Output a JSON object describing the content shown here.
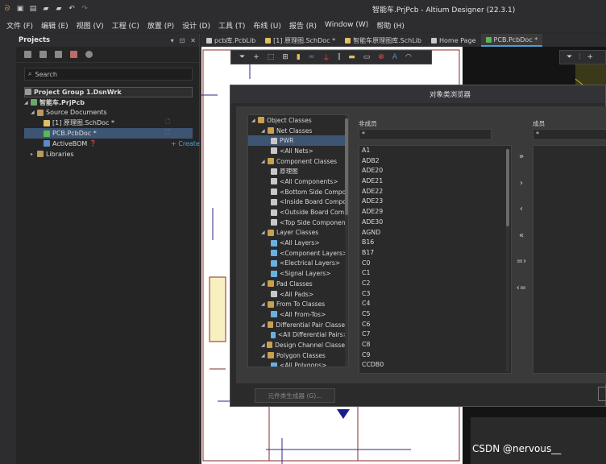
{
  "window": {
    "title": "智能车.PrjPcb - Altium Designer (22.3.1)"
  },
  "menu": [
    "文件 (F)",
    "编辑 (E)",
    "视图 (V)",
    "工程 (C)",
    "放置 (P)",
    "设计 (D)",
    "工具 (T)",
    "布线 (U)",
    "报告 (R)",
    "Window (W)",
    "帮助 (H)"
  ],
  "projects_panel": {
    "title": "Projects",
    "header_controls": [
      "▾",
      "⊡",
      "✕"
    ],
    "search_placeholder": "Search",
    "tree": {
      "group": "Project Group 1.DsnWrk",
      "project": "智能车.PrjPcb",
      "source_documents": "Source Documents",
      "sch_doc": "[1] 原理图.SchDoc *",
      "pcb_doc": "PCB.PcbDoc *",
      "active_bom": "ActiveBOM",
      "create": "+ Create",
      "libraries": "Libraries"
    }
  },
  "tabs": [
    {
      "label": "pcb库.PcbLib",
      "color": "#c8c8c8"
    },
    {
      "label": "[1] 原理图.SchDoc *",
      "color": "#e0c060"
    },
    {
      "label": "智能车原理图库.SchLib",
      "color": "#e0c060"
    },
    {
      "label": "Home Page",
      "color": "#c8c8c8"
    },
    {
      "label": "PCB.PcbDoc *",
      "color": "#58b858"
    }
  ],
  "dialog": {
    "title": "对象类浏览器",
    "tree": [
      {
        "label": "Object Classes",
        "level": 0
      },
      {
        "label": "Net Classes",
        "level": 1
      },
      {
        "label": "PWR",
        "level": 2,
        "selected": true
      },
      {
        "label": "<All Nets>",
        "level": 2
      },
      {
        "label": "Component Classes",
        "level": 1
      },
      {
        "label": "原理图",
        "level": 2
      },
      {
        "label": "<All Components>",
        "level": 2
      },
      {
        "label": "<Bottom Side Compo",
        "level": 2
      },
      {
        "label": "<Inside Board Compo",
        "level": 2
      },
      {
        "label": "<Outside Board Com",
        "level": 2
      },
      {
        "label": "<Top Side Componen",
        "level": 2
      },
      {
        "label": "Layer Classes",
        "level": 1
      },
      {
        "label": "<All Layers>",
        "level": 2
      },
      {
        "label": "<Component Layers>",
        "level": 2
      },
      {
        "label": "<Electrical Layers>",
        "level": 2
      },
      {
        "label": "<Signal Layers>",
        "level": 2
      },
      {
        "label": "Pad Classes",
        "level": 1
      },
      {
        "label": "<All Pads>",
        "level": 2
      },
      {
        "label": "From To Classes",
        "level": 1
      },
      {
        "label": "<All From-Tos>",
        "level": 2
      },
      {
        "label": "Differential Pair Classes",
        "level": 1
      },
      {
        "label": "<All Differential Pairs>",
        "level": 2
      },
      {
        "label": "Design Channel Classes",
        "level": 1
      },
      {
        "label": "Polygon Classes",
        "level": 1
      },
      {
        "label": "<All Polygons>",
        "level": 2
      }
    ],
    "nonmembers_label": "非成员",
    "members_label": "成员",
    "filter_value": "*",
    "members_filter_value": "*",
    "nonmembers": [
      "A1",
      "ADB2",
      "ADE20",
      "ADE21",
      "ADE22",
      "ADE23",
      "ADE29",
      "ADE30",
      "AGND",
      "B16",
      "B17",
      "C0",
      "C1",
      "C2",
      "C3",
      "C4",
      "C5",
      "C6",
      "C7",
      "C8",
      "C9",
      "CCDB0"
    ],
    "move_buttons": [
      "»",
      "›",
      "‹",
      "«",
      "=›",
      "‹="
    ],
    "footer_button": "元件类生成器 (G)..."
  },
  "watermark": "CSDN @nervous__"
}
